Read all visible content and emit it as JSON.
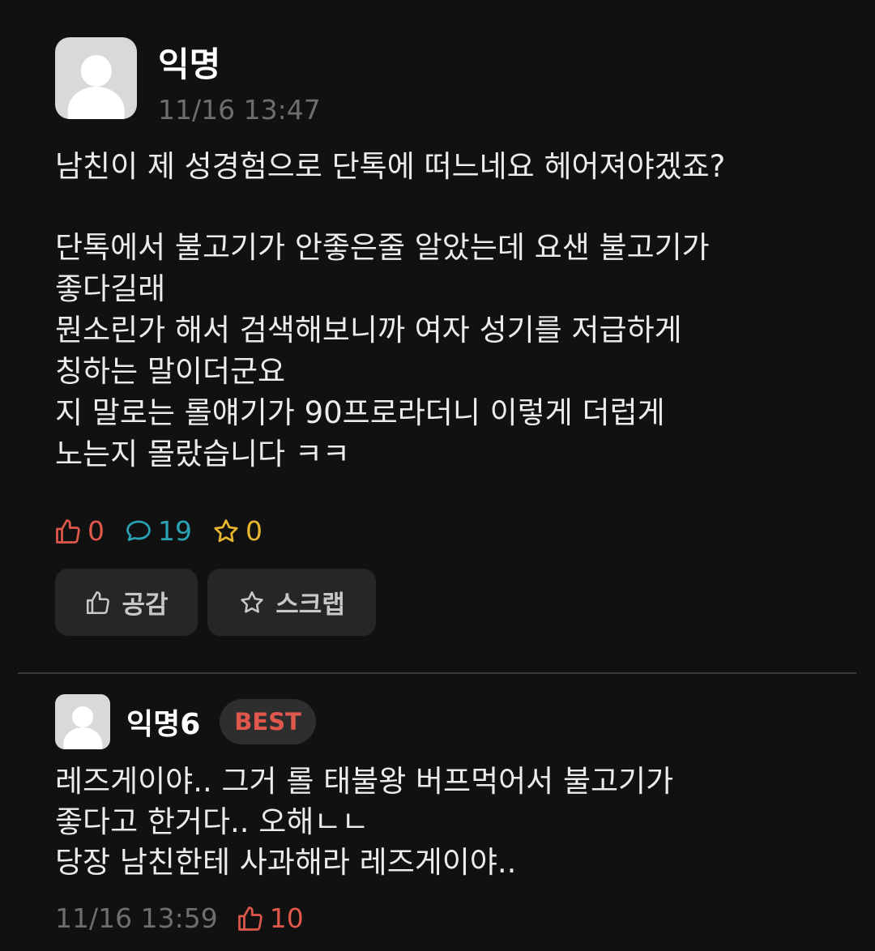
{
  "post": {
    "author": "익명",
    "datetime": "11/16 13:47",
    "title": "남친이 제 성경험으로 단톡에 떠느네요 헤어져야겠죠?",
    "body_lines": [
      "단톡에서 불고기가 안좋은줄 알았는데 요샌 불고기가",
      "좋다길래",
      "뭔소린가 해서 검색해보니까 여자 성기를 저급하게",
      "칭하는 말이더군요",
      "지 말로는 롤얘기가 90프로라더니 이렇게 더럽게",
      "노는지 몰랐습니다 ㅋㅋ"
    ],
    "stats": {
      "likes": "0",
      "comments": "19",
      "scraps": "0"
    },
    "actions": {
      "like_label": "공감",
      "scrap_label": "스크랩"
    }
  },
  "best_comment": {
    "author": "익명6",
    "badge": "BEST",
    "body_lines": [
      "레즈게이야.. 그거 롤 태불왕 버프먹어서 불고기가",
      "좋다고 한거다.. 오해ㄴㄴ",
      "당장 남친한테 사과해라 레즈게이야.."
    ],
    "datetime": "11/16 13:59",
    "likes": "10"
  },
  "colors": {
    "background": "#111111",
    "like": "#e0584c",
    "comment": "#2aa3b5",
    "scrap": "#e8b62e"
  },
  "icons": {
    "like": "thumbs-up-icon",
    "comment": "speech-bubble-icon",
    "scrap": "star-icon"
  }
}
